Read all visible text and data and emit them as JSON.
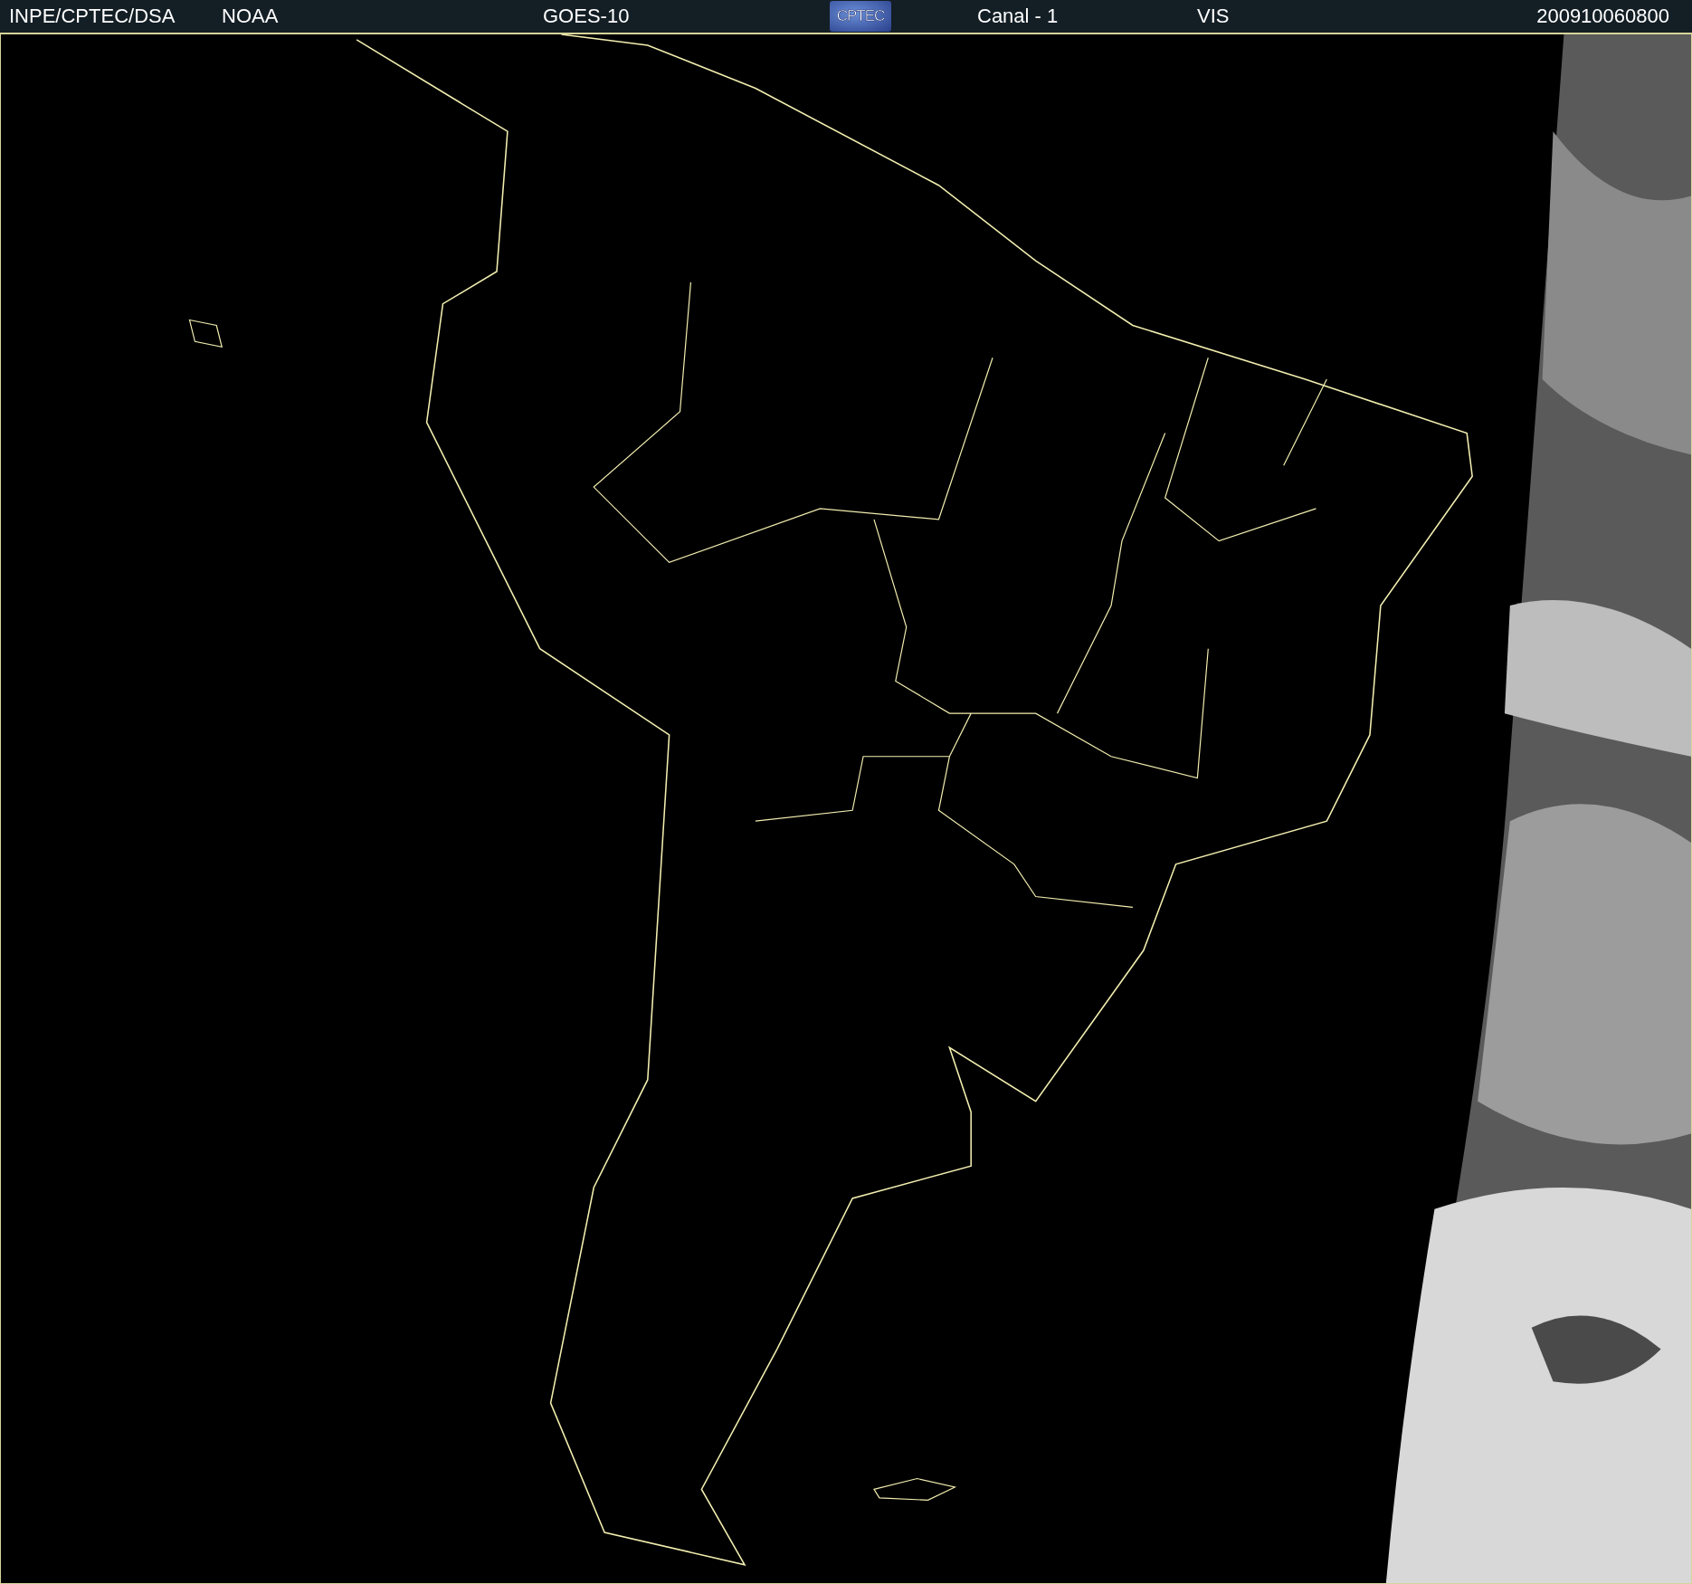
{
  "header": {
    "credit": "INPE/CPTEC/DSA",
    "agency": "NOAA",
    "satellite": "GOES-10",
    "logo_text": "CPTEC",
    "channel": "Canal - 1",
    "band": "VIS",
    "timestamp": "200910060800"
  }
}
